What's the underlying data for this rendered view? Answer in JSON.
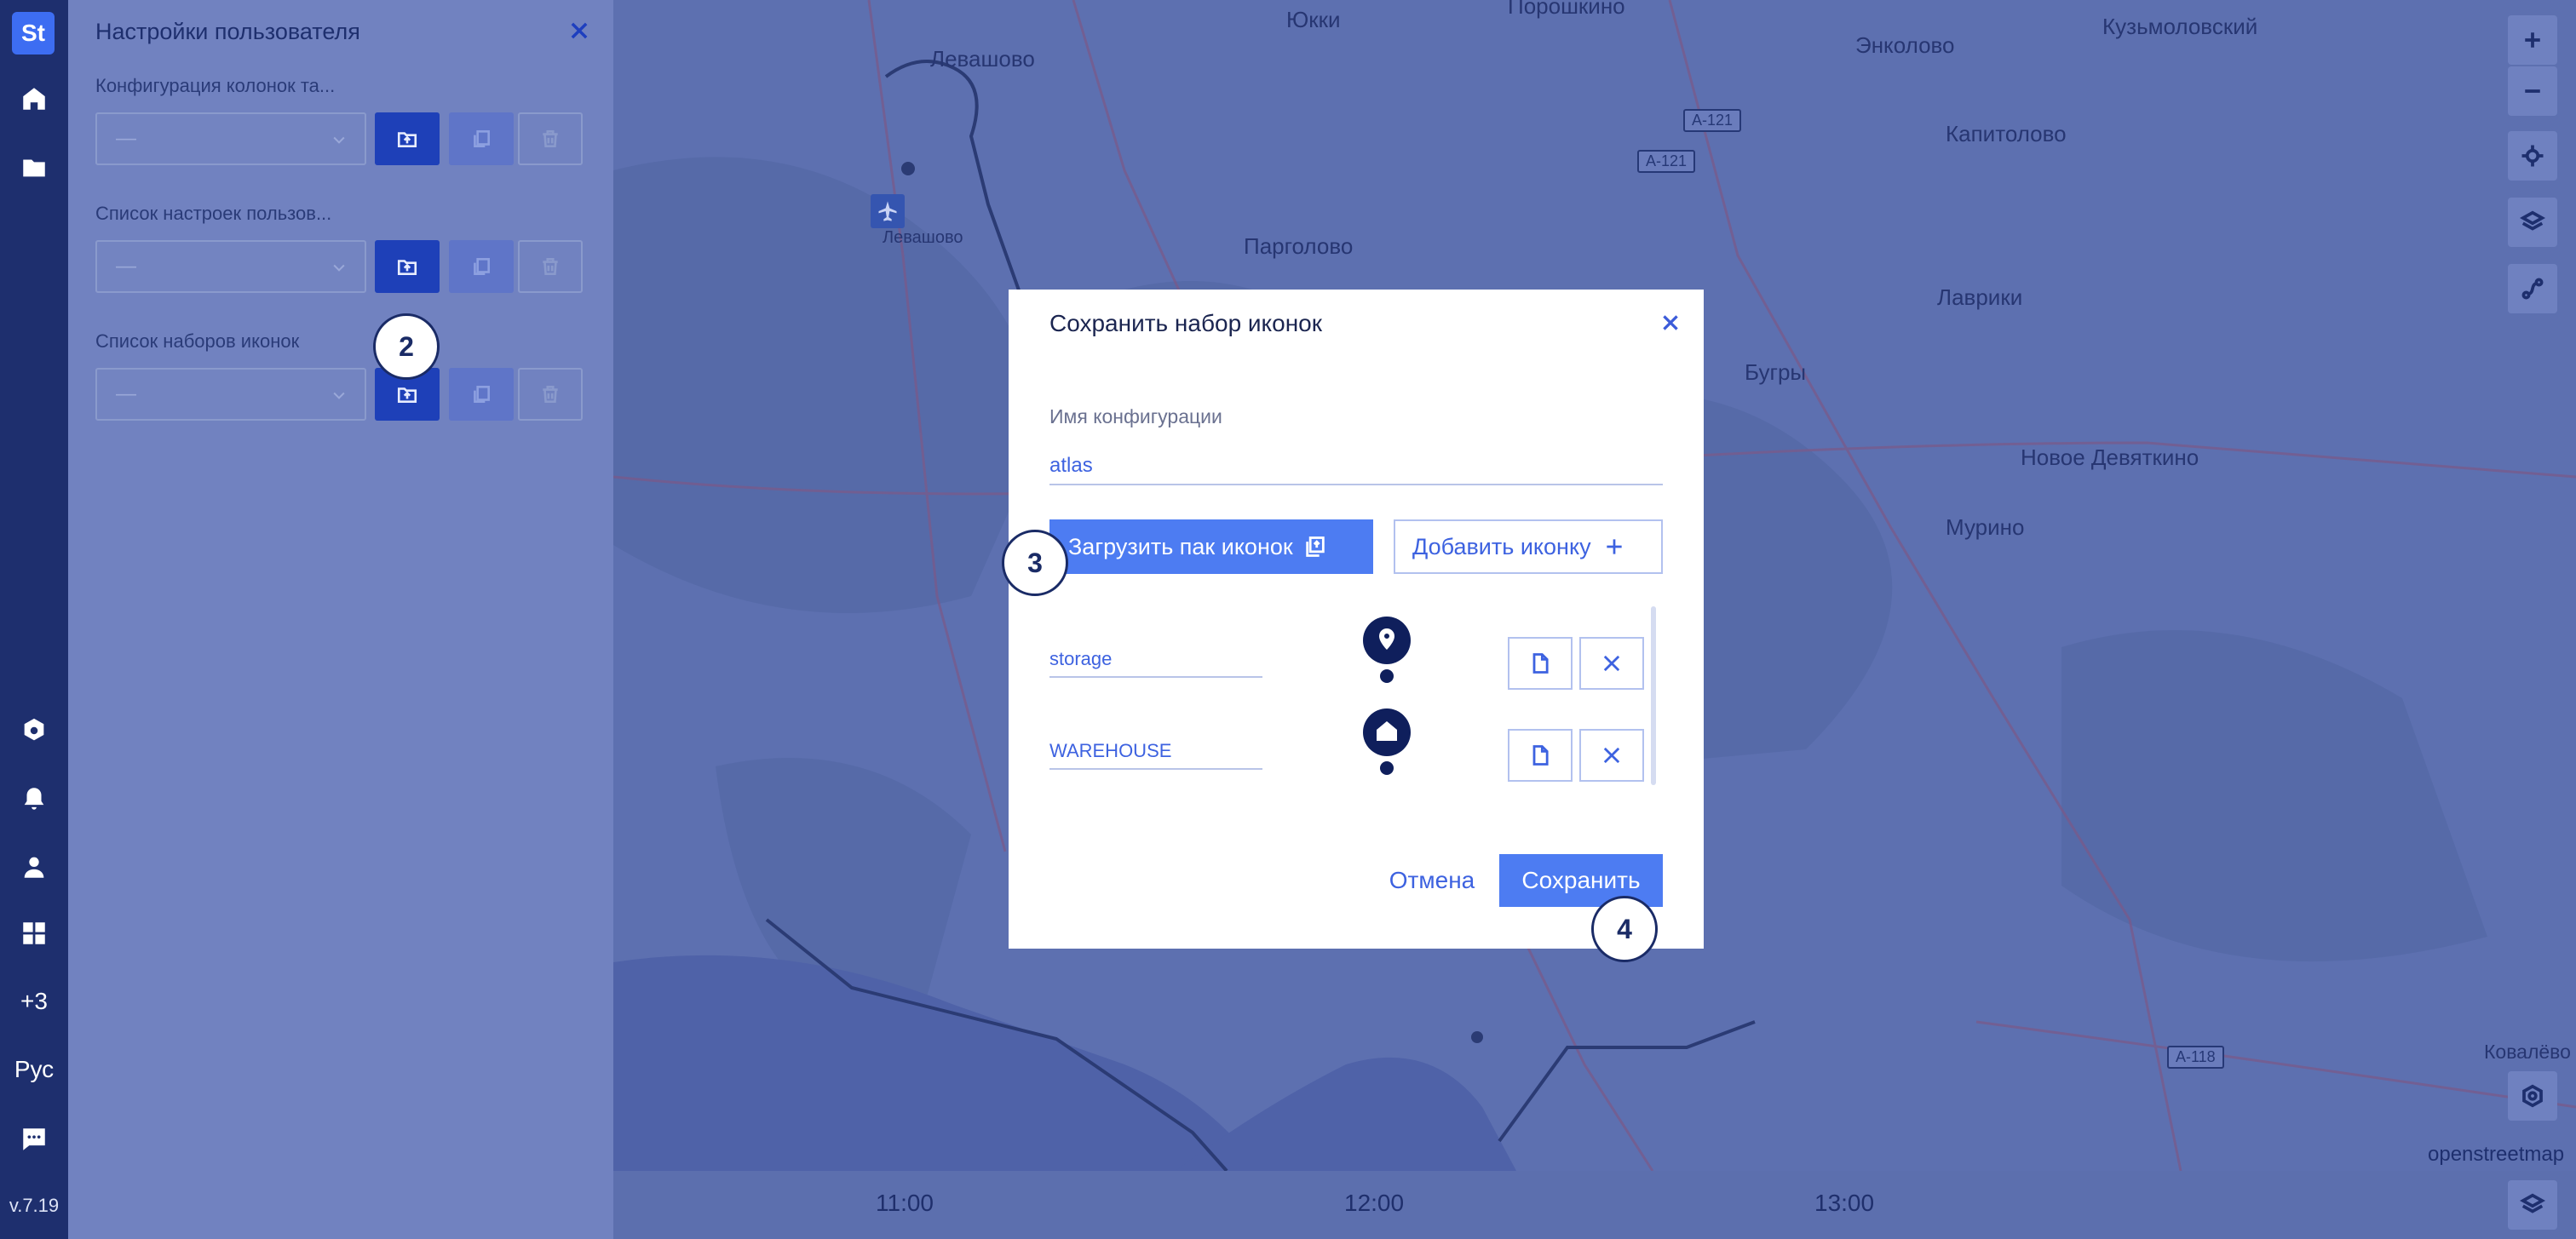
{
  "rail": {
    "logo": "St",
    "lang": "Рус",
    "more_count": "+3",
    "version": "v.7.19"
  },
  "panel": {
    "title": "Настройки пользователя",
    "sections": [
      {
        "label": "Конфигурация колонок та...",
        "value": "—"
      },
      {
        "label": "Список настроек пользов...",
        "value": "—"
      },
      {
        "label": "Список наборов иконок",
        "value": "—"
      }
    ]
  },
  "map": {
    "places": [
      "Юкки",
      "Порошкино",
      "Кузьмоловский",
      "Левашово",
      "Энколово",
      "Капитолово",
      "Левашово",
      "Парголово",
      "Лаврики",
      "Бугры",
      "Новое Девяткино",
      "Мурино",
      "Ковалёво"
    ],
    "roads": [
      "А-121",
      "А-121",
      "А-118"
    ],
    "attribution": "openstreetmap",
    "times": [
      "11:00",
      "12:00",
      "13:00"
    ]
  },
  "dialog": {
    "title": "Сохранить набор иконок",
    "name_label": "Имя конфигурации",
    "name_value": "atlas",
    "upload_label": "Загрузить пак иконок",
    "add_label": "Добавить иконку",
    "icons": [
      {
        "name": "storage",
        "icon": "map-pin-icon"
      },
      {
        "name": "WAREHOUSE",
        "icon": "home-pin-icon"
      }
    ],
    "cancel_label": "Отмена",
    "save_label": "Сохранить"
  },
  "badges": [
    "2",
    "3",
    "4"
  ],
  "colors": {
    "rail": "#1e2f6e",
    "accent": "#4d7cf2",
    "overlay": "#5b6fae"
  }
}
